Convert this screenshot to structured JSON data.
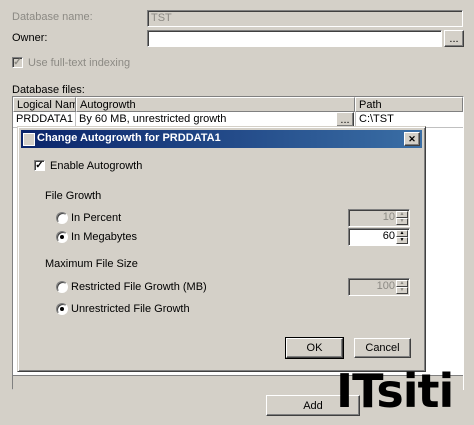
{
  "background_form": {
    "database_name_label": "Database name:",
    "database_name_value": "TST",
    "owner_label": "Owner:",
    "owner_value": "",
    "owner_browse": "...",
    "full_text_label": "Use full-text indexing",
    "full_text_checked": true,
    "database_files_label": "Database files:",
    "columns": [
      "Logical Name",
      "Autogrowth",
      "Path"
    ],
    "rows": [
      {
        "logical_name": "PRDDATA1",
        "autogrowth": "By 60 MB, unrestricted growth",
        "browse": "...",
        "path": "C:\\TST"
      }
    ],
    "add_button": "Add"
  },
  "dialog": {
    "title": "Change Autogrowth for PRDDATA1",
    "close_glyph": "✕",
    "enable_autogrowth_label": "Enable Autogrowth",
    "enable_autogrowth_checked": true,
    "file_growth_label": "File Growth",
    "in_percent_label": "In Percent",
    "in_percent_value": "10",
    "in_megabytes_label": "In Megabytes",
    "in_megabytes_value": "60",
    "file_growth_selected": "In Megabytes",
    "max_file_size_label": "Maximum File Size",
    "restricted_label": "Restricted File Growth (MB)",
    "restricted_value": "100",
    "unrestricted_label": "Unrestricted File Growth",
    "max_size_selected": "Unrestricted File Growth",
    "ok_button": "OK",
    "cancel_button": "Cancel",
    "check_glyph": "✓",
    "up_glyph": "▲",
    "down_glyph": "▼"
  },
  "watermark": "ITsiti",
  "colors": {
    "titlebar_start": "#0a246a",
    "titlebar_end": "#3a6ea5",
    "face": "#d4d0c8"
  }
}
